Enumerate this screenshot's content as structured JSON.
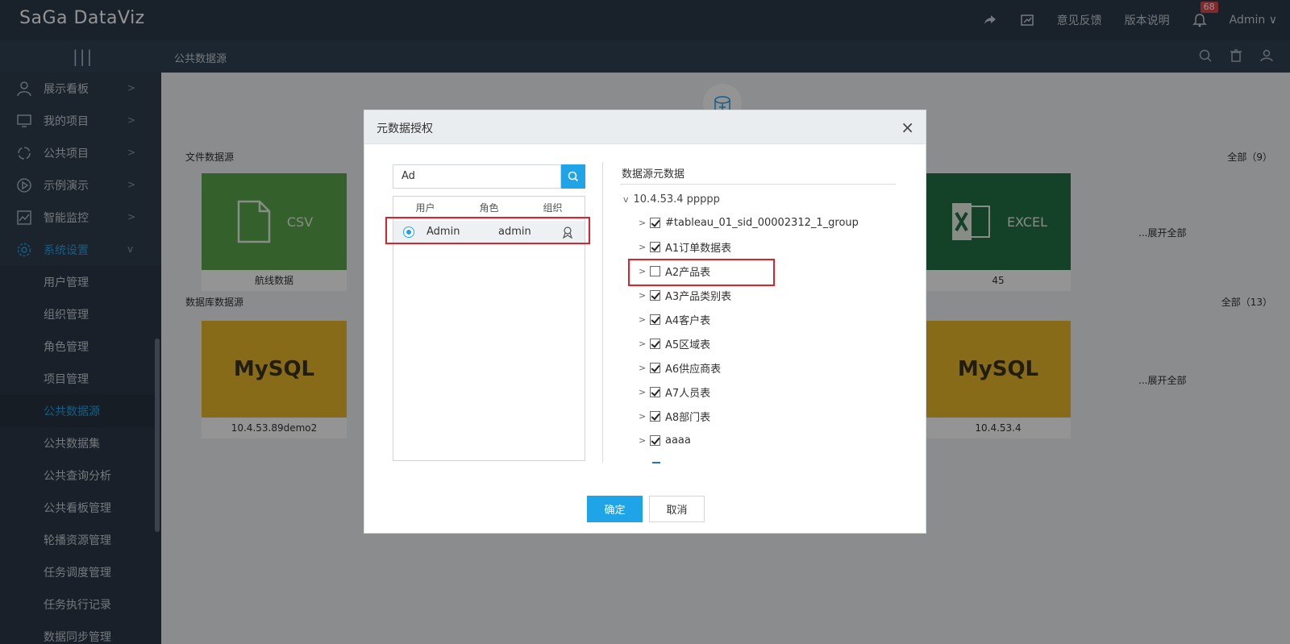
{
  "app": {
    "logo": "SaGa DataViz"
  },
  "topbar": {
    "feedback": "意见反馈",
    "release_notes": "版本说明",
    "notification_count": "68",
    "user": "Admin ∨"
  },
  "subbar": {
    "breadcrumb": "公共数据源"
  },
  "sidebar": {
    "items": [
      {
        "label": "展示看板"
      },
      {
        "label": "我的项目"
      },
      {
        "label": "公共项目"
      },
      {
        "label": "示例演示"
      },
      {
        "label": "智能监控"
      },
      {
        "label": "系统设置"
      }
    ],
    "sub_items": [
      {
        "label": "用户管理"
      },
      {
        "label": "组织管理"
      },
      {
        "label": "角色管理"
      },
      {
        "label": "项目管理"
      },
      {
        "label": "公共数据源"
      },
      {
        "label": "公共数据集"
      },
      {
        "label": "公共查询分析"
      },
      {
        "label": "公共看板管理"
      },
      {
        "label": "轮播资源管理"
      },
      {
        "label": "任务调度管理"
      },
      {
        "label": "任务执行记录"
      },
      {
        "label": "数据同步管理"
      }
    ]
  },
  "main": {
    "file_section": {
      "title": "文件数据源",
      "count": "全部（9）",
      "expand": "...展开全部"
    },
    "db_section": {
      "title": "数据库数据源",
      "count": "全部（13）",
      "expand": "...展开全部"
    },
    "cards": {
      "csv": {
        "label": "CSV",
        "caption": "航线数据"
      },
      "excel": {
        "label": "EXCEL",
        "caption": "45"
      },
      "mysql1": {
        "label": "MySQL",
        "caption": "10.4.53.89demo2"
      },
      "mysql2": {
        "label": "MySQL",
        "caption": "10.4.53.4"
      }
    }
  },
  "modal": {
    "title": "元数据授权",
    "search_value": "Ad",
    "tabs": [
      "用户",
      "角色",
      "组织"
    ],
    "user_row": {
      "name": "Admin",
      "login": "admin"
    },
    "tree_title": "数据源元数据",
    "tree_root": "10.4.53.4 ppppp",
    "tree_items": [
      {
        "label": "#tableau_01_sid_00002312_1_group",
        "checked": true
      },
      {
        "label": "A1订单数据表",
        "checked": true
      },
      {
        "label": "A2产品表",
        "checked": false
      },
      {
        "label": "A3产品类别表",
        "checked": true
      },
      {
        "label": "A4客户表",
        "checked": true
      },
      {
        "label": "A5区域表",
        "checked": true
      },
      {
        "label": "A6供应商表",
        "checked": true
      },
      {
        "label": "A7人员表",
        "checked": true
      },
      {
        "label": "A8部门表",
        "checked": true
      },
      {
        "label": "aaaa",
        "checked": true
      }
    ],
    "ok_label": "确定",
    "cancel_label": "取消"
  },
  "colors": {
    "accent": "#20a4e8",
    "highlight": "#e0202a",
    "csv_green": "#5ba84a",
    "excel_green": "#217346",
    "mysql_yellow": "#e8b92c"
  }
}
